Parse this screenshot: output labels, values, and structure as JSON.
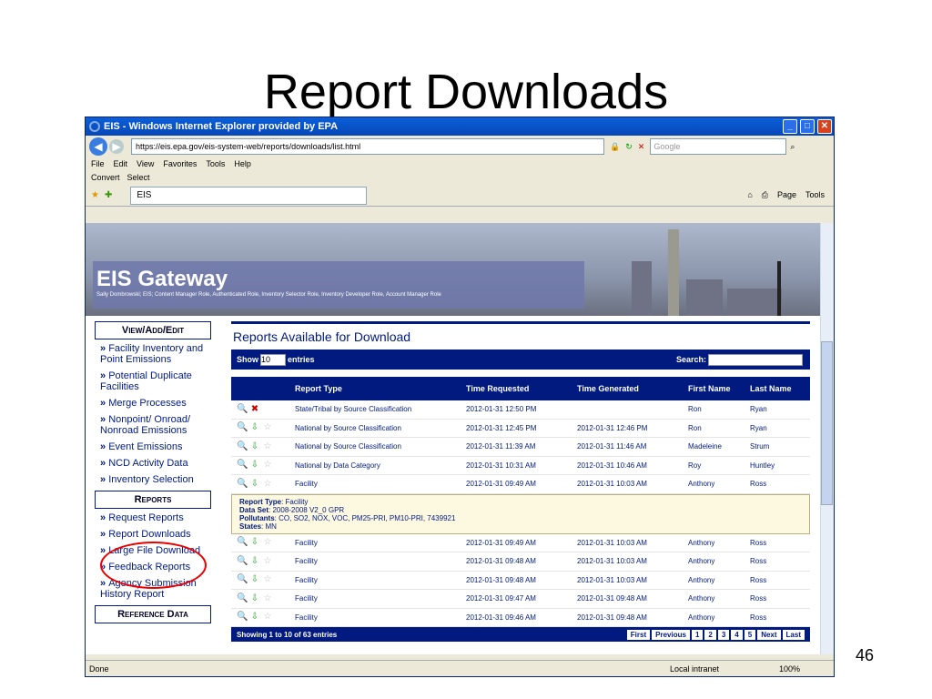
{
  "slide": {
    "title": "Report Downloads",
    "number": "46"
  },
  "window": {
    "title": "EIS - Windows Internet Explorer provided by EPA",
    "url": "https://eis.epa.gov/eis-system-web/reports/downloads/list.html",
    "search_placeholder": "Google",
    "tab": "EIS",
    "status_left": "Done",
    "status_zone": "Local intranet",
    "zoom": "100%"
  },
  "menu": [
    "File",
    "Edit",
    "View",
    "Favorites",
    "Tools",
    "Help"
  ],
  "cmd": {
    "convert": "Convert",
    "select": "Select",
    "page": "Page",
    "tools": "Tools"
  },
  "banner": {
    "title": "EIS Gateway",
    "user": "Sally Dombrowski; EIS; Content Manager Role, Authenticated Role, Inventory Selector Role, Inventory Developer Role, Account Manager Role"
  },
  "side": {
    "head1": "View/Add/Edit",
    "links1": [
      "Facility Inventory and Point Emissions",
      "Potential Duplicate Facilities",
      "Merge Processes",
      "Nonpoint/ Onroad/ Nonroad Emissions",
      "Event Emissions",
      "NCD Activity Data",
      "Inventory Selection"
    ],
    "head2": "Reports",
    "links2": [
      "Request Reports",
      "Report Downloads",
      "Large File Download",
      "Feedback Reports",
      "Agency Submission History Report"
    ],
    "head3": "Reference Data"
  },
  "main": {
    "heading": "Reports Available for Download",
    "show": "Show",
    "entries_val": "10",
    "entries": "entries",
    "search": "Search:",
    "cols": [
      "",
      "Report Type",
      "Time Requested",
      "Time Generated",
      "First Name",
      "Last Name"
    ],
    "rows": [
      [
        "State/Tribal by Source Classification",
        "2012-01-31 12:50 PM",
        "",
        "Ron",
        "Ryan"
      ],
      [
        "National by Source Classification",
        "2012-01-31 12:45 PM",
        "2012-01-31 12:46 PM",
        "Ron",
        "Ryan"
      ],
      [
        "National by Source Classification",
        "2012-01-31 11:39 AM",
        "2012-01-31 11:46 AM",
        "Madeleine",
        "Strum"
      ],
      [
        "National by Data Category",
        "2012-01-31 10:31 AM",
        "2012-01-31 10:46 AM",
        "Roy",
        "Huntley"
      ],
      [
        "Facility",
        "2012-01-31 09:49 AM",
        "2012-01-31 10:03 AM",
        "Anthony",
        "Ross"
      ]
    ],
    "detail": {
      "type_l": "Report Type",
      "type_v": "Facility",
      "ds_l": "Data Set",
      "ds_v": "2008-2008 V2_0 GPR",
      "pol_l": "Pollutants",
      "pol_v": "CO, SO2, NOX, VOC, PM25-PRI, PM10-PRI, 7439921",
      "st_l": "States",
      "st_v": "MN"
    },
    "rows2": [
      [
        "Facility",
        "2012-01-31 09:49 AM",
        "2012-01-31 10:03 AM",
        "Anthony",
        "Ross"
      ],
      [
        "Facility",
        "2012-01-31 09:48 AM",
        "2012-01-31 10:03 AM",
        "Anthony",
        "Ross"
      ],
      [
        "Facility",
        "2012-01-31 09:48 AM",
        "2012-01-31 10:03 AM",
        "Anthony",
        "Ross"
      ],
      [
        "Facility",
        "2012-01-31 09:47 AM",
        "2012-01-31 09:48 AM",
        "Anthony",
        "Ross"
      ],
      [
        "Facility",
        "2012-01-31 09:46 AM",
        "2012-01-31 09:48 AM",
        "Anthony",
        "Ross"
      ]
    ],
    "footer": "Showing 1 to 10 of 63 entries",
    "pager": [
      "First",
      "Previous",
      "1",
      "2",
      "3",
      "4",
      "5",
      "Next",
      "Last"
    ]
  }
}
